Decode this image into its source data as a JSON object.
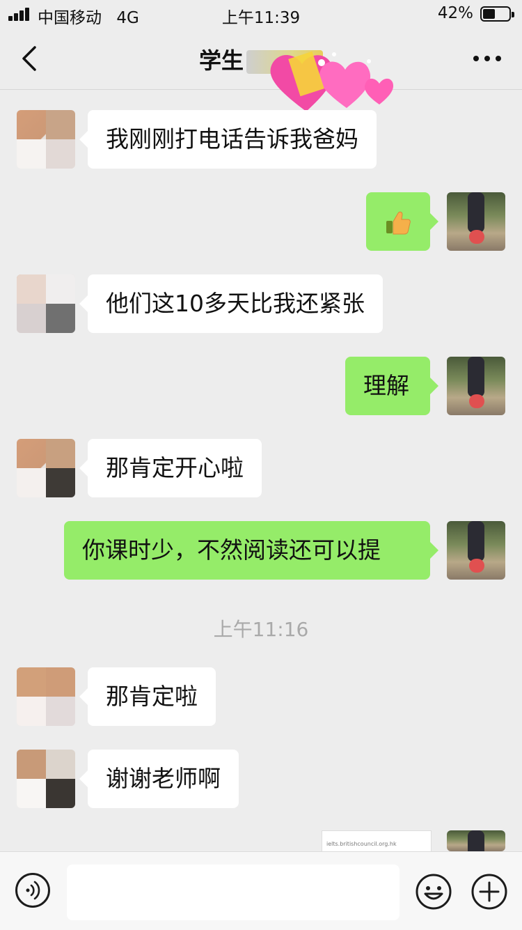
{
  "status_bar": {
    "carrier": "中国移动",
    "network": "4G",
    "time": "上午11:39",
    "battery_percent": "42%",
    "battery_level": 0.42
  },
  "nav": {
    "title": "学生"
  },
  "messages": [
    {
      "side": "left",
      "text": "我刚刚打电话告诉我爸妈"
    },
    {
      "side": "right",
      "icon": "thumbs-up-icon"
    },
    {
      "side": "left",
      "text": "他们这10多天比我还紧张"
    },
    {
      "side": "right",
      "text": "理解"
    },
    {
      "side": "left",
      "text": "那肯定开心啦"
    },
    {
      "side": "right",
      "text": "你课时少，不然阅读还可以提"
    },
    {
      "side": "left",
      "text": "那肯定啦"
    },
    {
      "side": "left",
      "text": "谢谢老师啊"
    }
  ],
  "timestamp": "上午11:16",
  "shared_image": {
    "url_text": "ielts.britishcouncil.org.hk"
  },
  "input": {
    "value": ""
  },
  "colors": {
    "background": "#ededed",
    "outgoing_bubble": "#95ec69",
    "incoming_bubble": "#ffffff",
    "timestamp": "#a9a9a9"
  }
}
